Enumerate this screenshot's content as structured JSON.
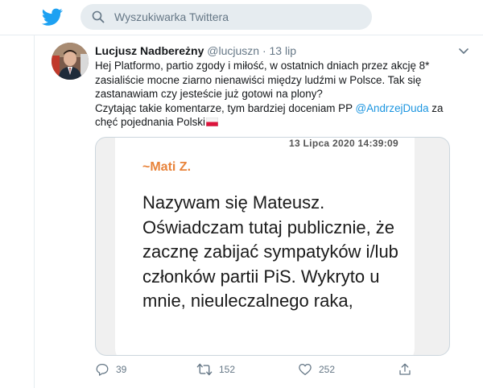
{
  "search": {
    "placeholder": "Wyszukiwarka Twittera"
  },
  "tweet": {
    "author_name": "Lucjusz Nadbereżny",
    "author_handle": "@lucjuszn",
    "separator": "·",
    "time": "13 lip",
    "text_line1": "Hej Platformo, partio zgody i miłość, w ostatnich dniach przez akcję 8* zasialiście mocne ziarno nienawiści między ludźmi w Polsce. Tak się zastanawiam czy jesteście już gotowi na plony?",
    "text_line2_before": "Czytając takie komentarze, tym bardziej doceniam PP ",
    "text_mention": "@AndrzejDuda",
    "text_line2_after": " za chęć pojednania Polski"
  },
  "media": {
    "date": "13 Lipca 2020  14:39:09",
    "sender": "~Mati Z.",
    "message": "Nazywam się Mateusz. Oświadczam tutaj publicznie, że zacznę zabijać sympatyków i/lub członków partii PiS. Wykryto u mnie, nieuleczalnego raka,"
  },
  "actions": {
    "replies": "39",
    "retweets": "152",
    "likes": "252"
  },
  "colors": {
    "twitter_blue": "#1da1f2",
    "link": "#1b95e0",
    "muted": "#657786",
    "sender_orange": "#e8833a"
  },
  "icons": [
    "twitter-bird-logo",
    "search-icon",
    "chevron-down-icon",
    "reply-icon",
    "retweet-icon",
    "like-icon",
    "share-icon",
    "poland-flag-icon"
  ]
}
